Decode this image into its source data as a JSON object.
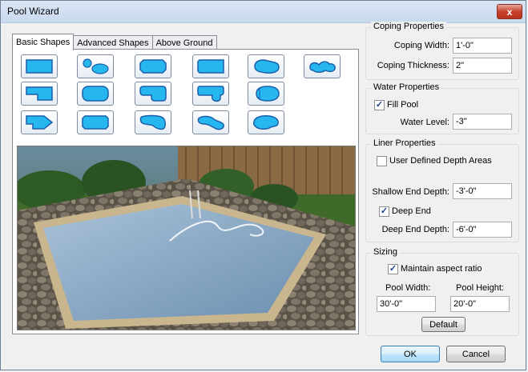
{
  "window": {
    "title": "Pool Wizard",
    "close_glyph": "x"
  },
  "tabs": [
    {
      "label": "Basic Shapes",
      "active": true
    },
    {
      "label": "Advanced Shapes",
      "active": false
    },
    {
      "label": "Above Ground",
      "active": false
    }
  ],
  "shapes": [
    "rectangle-shape-icon",
    "rectangle-spa-shape-icon",
    "octagon-shape-icon",
    "clipped-rectangle-shape-icon",
    "kidney-shape-icon",
    "freeform-lagoon-shape-icon",
    "l-shape-icon",
    "rounded-rectangle-shape-icon",
    "rounded-l-shape-icon",
    "keyhole-shape-icon",
    "lazy-l-shape-icon",
    "arrow-end-shape-icon",
    "oval-ends-shape-icon",
    "curved-l-shape-icon",
    "bean-shape-icon",
    "curved-freeform-shape-icon"
  ],
  "coping": {
    "legend": "Coping Properties",
    "width_label": "Coping Width:",
    "width_value": "1'-0\"",
    "thickness_label": "Coping Thickness:",
    "thickness_value": "2\""
  },
  "water": {
    "legend": "Water Properties",
    "fill_label": "Fill Pool",
    "fill_checked": true,
    "level_label": "Water Level:",
    "level_value": "-3\""
  },
  "liner": {
    "legend": "Liner Properties",
    "user_defined_label": "User Defined Depth Areas",
    "user_defined_checked": false,
    "shallow_label": "Shallow End Depth:",
    "shallow_value": "-3'-0\"",
    "deep_end_label": "Deep End",
    "deep_end_checked": true,
    "deep_label": "Deep End Depth:",
    "deep_value": "-6'-0\""
  },
  "sizing": {
    "legend": "Sizing",
    "aspect_label": "Maintain aspect ratio",
    "aspect_checked": true,
    "width_label": "Pool Width:",
    "width_value": "30'-0\"",
    "height_label": "Pool Height:",
    "height_value": "20'-0\"",
    "default_label": "Default"
  },
  "footer": {
    "ok_label": "OK",
    "cancel_label": "Cancel"
  },
  "colors": {
    "shape_fill": "#27b7f0",
    "shape_stroke": "#1a5fa8"
  }
}
